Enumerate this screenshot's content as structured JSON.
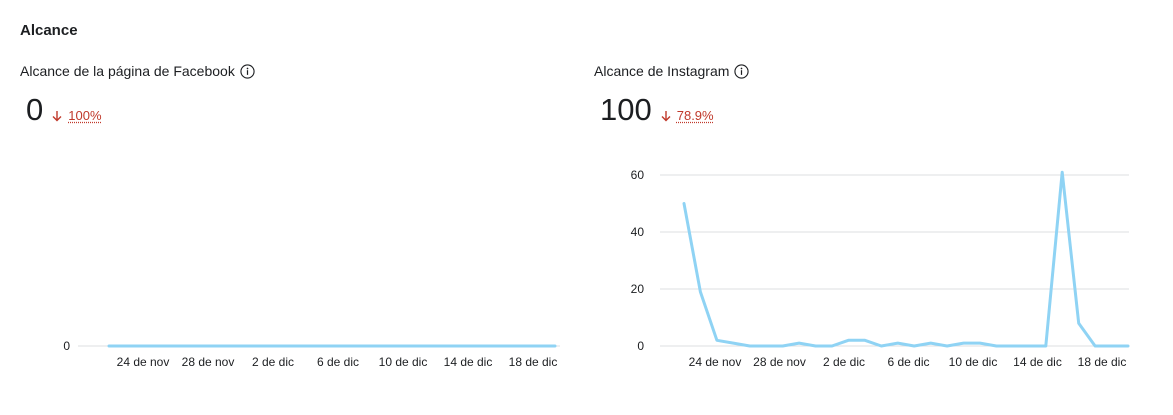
{
  "section": {
    "title": "Alcance"
  },
  "facebook": {
    "label": "Alcance de la página de Facebook",
    "value": "0",
    "delta": "100%",
    "chart_data": {
      "type": "line",
      "x_ticks": [
        "24 de nov",
        "28 de nov",
        "2 de dic",
        "6 de dic",
        "10 de dic",
        "14 de dic",
        "18 de dic"
      ],
      "y_ticks": [
        0
      ],
      "ylim": [
        0,
        0
      ],
      "grid": true,
      "series": [
        {
          "values": [
            0,
            0,
            0,
            0,
            0,
            0,
            0,
            0,
            0,
            0,
            0,
            0,
            0,
            0,
            0,
            0,
            0,
            0,
            0,
            0,
            0,
            0,
            0,
            0,
            0,
            0,
            0,
            0,
            0,
            0,
            0,
            0
          ]
        }
      ],
      "color": "#8fd3f4"
    }
  },
  "instagram": {
    "label": "Alcance de Instagram",
    "value": "100",
    "delta": "78.9%",
    "chart_data": {
      "type": "line",
      "x_ticks": [
        "24 de nov",
        "28 de nov",
        "2 de dic",
        "6 de dic",
        "10 de dic",
        "14 de dic",
        "18 de dic"
      ],
      "y_ticks": [
        0,
        20,
        40,
        60
      ],
      "ylim": [
        0,
        60
      ],
      "grid": true,
      "series": [
        {
          "values": [
            50,
            19,
            2,
            1,
            0,
            0,
            0,
            1,
            0,
            0,
            2,
            2,
            0,
            1,
            0,
            1,
            0,
            1,
            1,
            0,
            0,
            0,
            0,
            61,
            8,
            0,
            0,
            0
          ]
        }
      ],
      "color": "#8fd3f4"
    }
  },
  "colors": {
    "delta": "#c0392b",
    "line": "#8fd3f4",
    "grid": "#dddfe2"
  }
}
